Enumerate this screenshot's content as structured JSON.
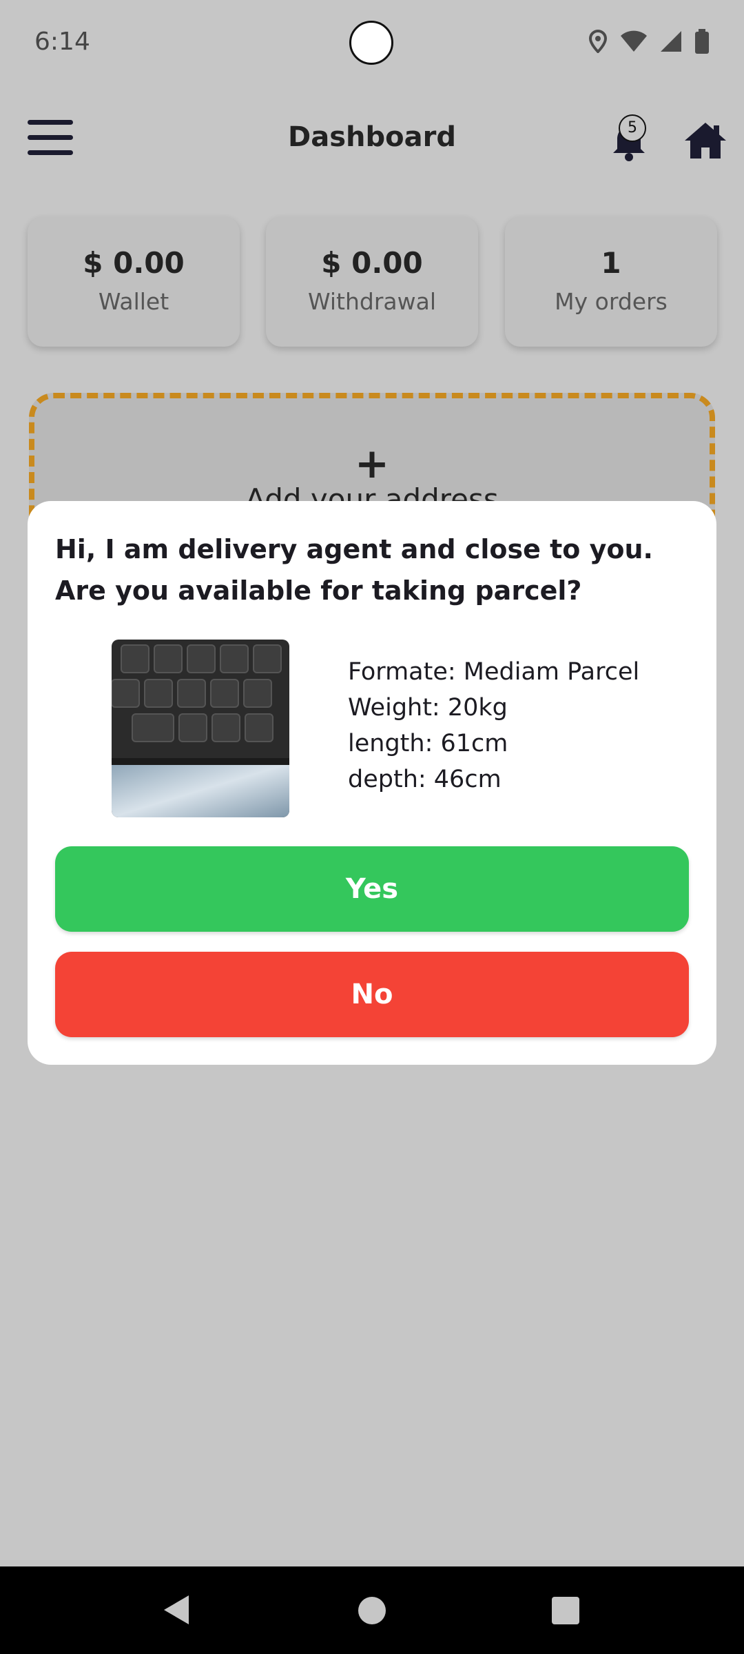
{
  "status_bar": {
    "time": "6:14",
    "icons": [
      "location-icon",
      "wifi-icon",
      "cell-signal-icon",
      "battery-icon"
    ]
  },
  "app_bar": {
    "title": "Dashboard",
    "notification_count": "5",
    "icons": [
      "menu-icon",
      "bell-icon",
      "home-icon"
    ]
  },
  "stats": [
    {
      "value": "$ 0.00",
      "label": "Wallet"
    },
    {
      "value": "$ 0.00",
      "label": "Withdrawal"
    },
    {
      "value": "1",
      "label": "My orders"
    }
  ],
  "address": {
    "plus": "+",
    "label": "Add your address"
  },
  "modal": {
    "message": "Hi, I am delivery agent and close to you. Are you available for taking parcel?",
    "details": [
      "Formate: Mediam Parcel",
      "Weight: 20kg",
      "length: 61cm",
      "depth: 46cm"
    ],
    "yes_label": "Yes",
    "no_label": "No"
  },
  "colors": {
    "yes": "#34c75c",
    "no": "#f44336",
    "dashed_border": "#c98a1e",
    "overlay_bg": "#c6c6c6"
  }
}
